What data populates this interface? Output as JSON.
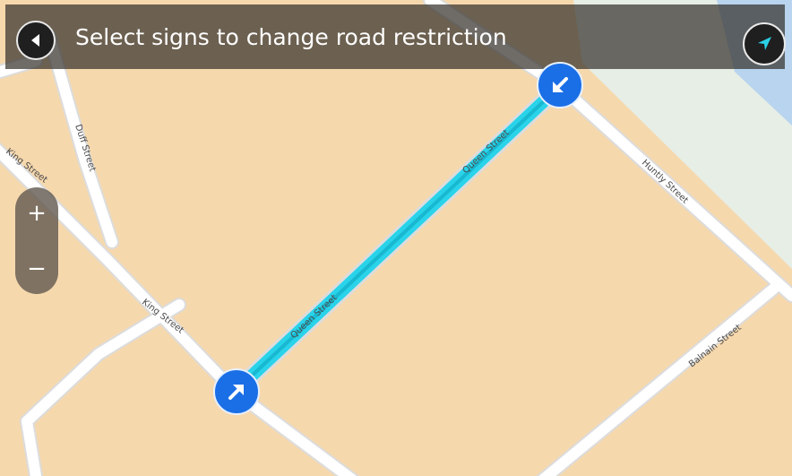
{
  "header": {
    "title": "Select signs to change road restriction",
    "back_icon": "back-arrow-icon",
    "location_icon": "current-location-arrow-icon"
  },
  "zoom": {
    "in_label": "+",
    "out_label": "−"
  },
  "map": {
    "streets": {
      "duff": "Duff Street",
      "king_upper": "King Street",
      "king_lower": "King Street",
      "queen_upper": "Queen Street",
      "queen_lower": "Queen Street",
      "huntly": "Huntly Street",
      "balnain": "Balnain Street"
    },
    "selected_segment_color": "#29d3ea",
    "sign_color": "#1a6fe6"
  },
  "signs": {
    "start_icon": "direction-arrow-up-right-icon",
    "end_icon": "direction-arrow-down-left-icon"
  }
}
